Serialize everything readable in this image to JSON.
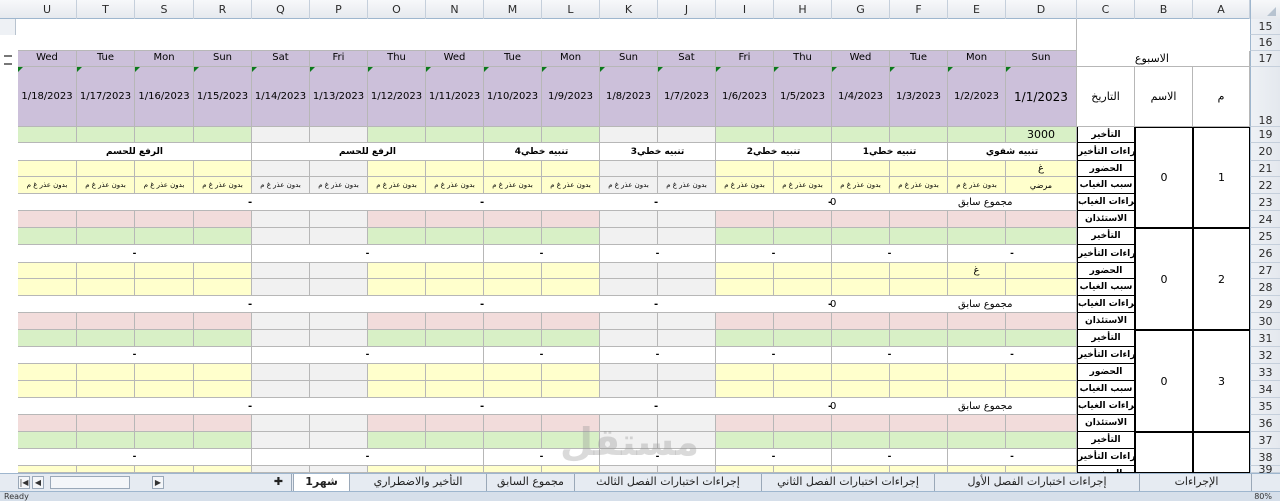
{
  "columns": [
    "U",
    "T",
    "S",
    "R",
    "Q",
    "P",
    "O",
    "N",
    "M",
    "L",
    "K",
    "J",
    "I",
    "H",
    "G",
    "F",
    "E",
    "D",
    "C",
    "B",
    "A"
  ],
  "rows": [
    "15",
    "16",
    "17",
    "18",
    "19",
    "20",
    "21",
    "22",
    "23",
    "24",
    "25",
    "26",
    "27",
    "28",
    "29",
    "30",
    "31",
    "32",
    "33",
    "34",
    "35",
    "36",
    "37",
    "38",
    "39"
  ],
  "header": {
    "week_label": "الاسبوع",
    "date_label": "التاريخ",
    "name_label": "الاسم",
    "num_label": "م"
  },
  "days": [
    "Wed",
    "Tue",
    "Mon",
    "Sun",
    "Sat",
    "Fri",
    "Thu",
    "Wed",
    "Tue",
    "Mon",
    "Sun",
    "Sat",
    "Fri",
    "Thu",
    "Wed",
    "Tue",
    "Mon",
    "Sun"
  ],
  "dates": [
    "1/18/2023",
    "1/17/2023",
    "1/16/2023",
    "1/15/2023",
    "1/14/2023",
    "1/13/2023",
    "1/12/2023",
    "1/11/2023",
    "1/10/2023",
    "1/9/2023",
    "1/8/2023",
    "1/7/2023",
    "1/6/2023",
    "1/5/2023",
    "1/4/2023",
    "1/3/2023",
    "1/2/2023",
    "1/1/2023"
  ],
  "labels": {
    "late": "التأخير",
    "late_actions": "اجراءات التأخير",
    "attendance": "الحضور",
    "absence_reason": "سبب الغياب",
    "absence_actions": "اجراءات الغياب",
    "permission": "الاستئذان"
  },
  "block1": {
    "late_value": "3000",
    "actions": [
      "الرفع للحسم",
      "الرفع للحسم",
      "تنبيه خطي4",
      "تنبيه خطي3",
      "تنبيه خطي2",
      "تنبيه خطي1",
      "تنبيه شفوي"
    ],
    "attendance_mark": "غ",
    "reason_cell": "بدون عذر غ م",
    "reason_sick": "مرضي",
    "prev_total_label": "مجموع سابق",
    "prev_total_value": "0",
    "dash": "-"
  },
  "block2": {
    "attendance_mark": "غ",
    "prev_total_label": "مجموع سابق",
    "prev_total_value": "0",
    "dash": "-"
  },
  "block3": {
    "prev_total_label": "مجموع سابق",
    "prev_total_value": "0",
    "dash": "-"
  },
  "students": [
    {
      "num": "1",
      "name": "0"
    },
    {
      "num": "2",
      "name": "0"
    },
    {
      "num": "3",
      "name": "0"
    }
  ],
  "tabs": [
    "الإجراءات",
    "إجراءات اختبارات الفصل الأول",
    "إجراءات اختبارات الفصل الثاني",
    "إجراءات اختبارات الفصل الثالث",
    "مجموع السابق",
    "التأخير والاضطراري",
    "شهر1"
  ],
  "status": {
    "ready": "Ready",
    "zoom": "80%"
  },
  "watermark": "مستقل"
}
